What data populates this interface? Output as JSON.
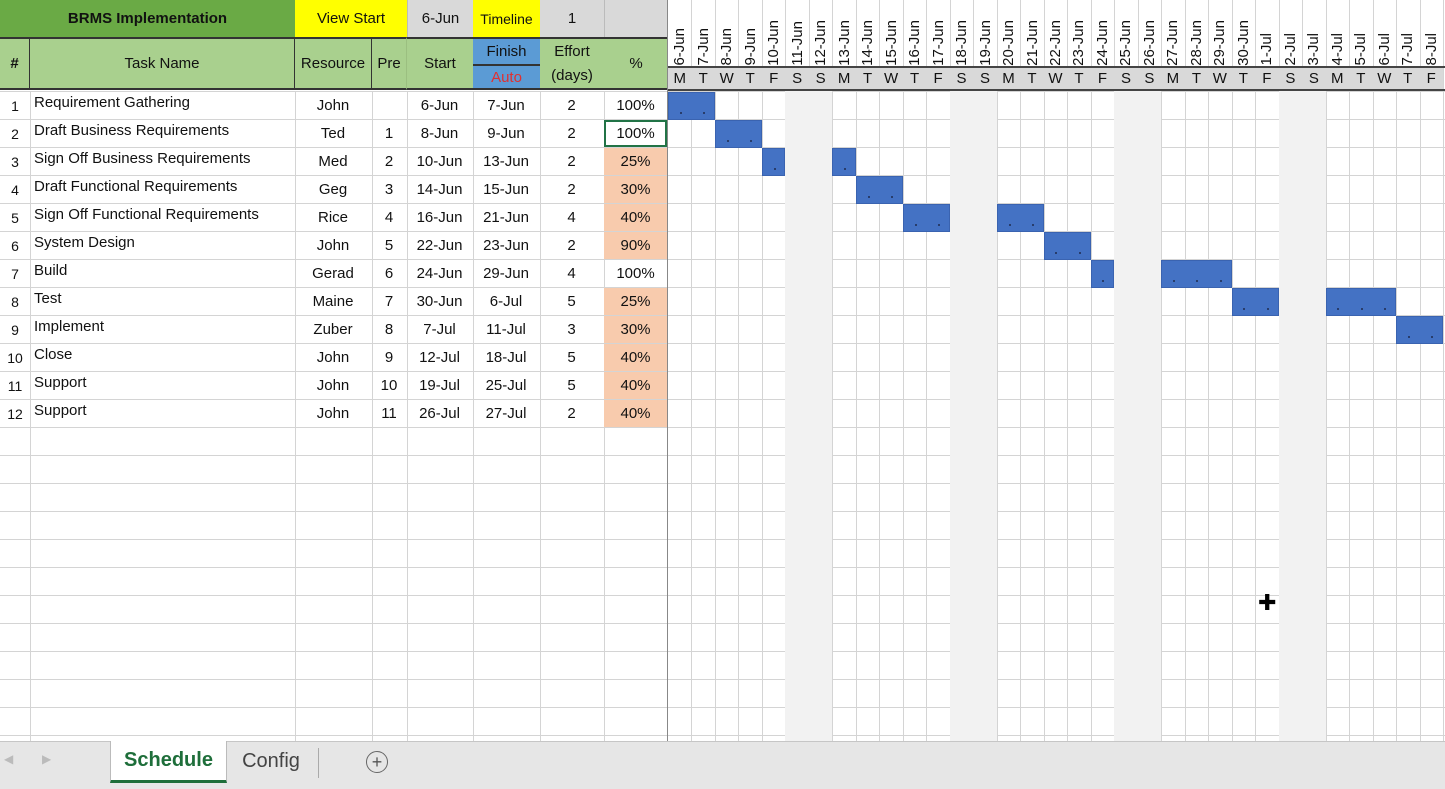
{
  "header": {
    "title": "BRMS Implementation",
    "view_start_label": "View Start",
    "view_start_value": "6-Jun",
    "timeline_label": "Timeline",
    "timeline_value": "1",
    "blank": ""
  },
  "columns": {
    "num": "#",
    "task": "Task Name",
    "resource": "Resource",
    "pre": "Pre",
    "start": "Start",
    "finish": "Finish",
    "finish_mode": "Auto",
    "effort": "Effort",
    "effort_unit": "(days)",
    "pct": "%"
  },
  "tasks": [
    {
      "num": "1",
      "name": "Requirement Gathering",
      "resource": "John",
      "pre": "",
      "start": "6-Jun",
      "finish": "7-Jun",
      "effort": "2",
      "pct": "100%",
      "highlight": false,
      "bar_days": [
        0,
        1
      ]
    },
    {
      "num": "2",
      "name": "Draft Business Requirements",
      "resource": "Ted",
      "pre": "1",
      "start": "8-Jun",
      "finish": "9-Jun",
      "effort": "2",
      "pct": "100%",
      "highlight": false,
      "selected": true,
      "bar_days": [
        2,
        3
      ]
    },
    {
      "num": "3",
      "name": "Sign Off Business Requirements",
      "resource": "Med",
      "pre": "2",
      "start": "10-Jun",
      "finish": "13-Jun",
      "effort": "2",
      "pct": "25%",
      "highlight": true,
      "bar_days": [
        4,
        7
      ]
    },
    {
      "num": "4",
      "name": "Draft Functional Requirements",
      "resource": "Geg",
      "pre": "3",
      "start": "14-Jun",
      "finish": "15-Jun",
      "effort": "2",
      "pct": "30%",
      "highlight": true,
      "bar_days": [
        8,
        9
      ]
    },
    {
      "num": "5",
      "name": "Sign Off Functional Requirements",
      "resource": "Rice",
      "pre": "4",
      "start": "16-Jun",
      "finish": "21-Jun",
      "effort": "4",
      "pct": "40%",
      "highlight": true,
      "bar_days": [
        10,
        11,
        14,
        15
      ]
    },
    {
      "num": "6",
      "name": "System Design",
      "resource": "John",
      "pre": "5",
      "start": "22-Jun",
      "finish": "23-Jun",
      "effort": "2",
      "pct": "90%",
      "highlight": true,
      "bar_days": [
        16,
        17
      ]
    },
    {
      "num": "7",
      "name": "Build",
      "resource": "Gerad",
      "pre": "6",
      "start": "24-Jun",
      "finish": "29-Jun",
      "effort": "4",
      "pct": "100%",
      "highlight": false,
      "bar_days": [
        18,
        21,
        22,
        23
      ]
    },
    {
      "num": "8",
      "name": "Test",
      "resource": "Maine",
      "pre": "7",
      "start": "30-Jun",
      "finish": "6-Jul",
      "effort": "5",
      "pct": "25%",
      "highlight": true,
      "bar_days": [
        24,
        25,
        28,
        29,
        30
      ]
    },
    {
      "num": "9",
      "name": "Implement",
      "resource": "Zuber",
      "pre": "8",
      "start": "7-Jul",
      "finish": "11-Jul",
      "effort": "3",
      "pct": "30%",
      "highlight": true,
      "bar_days": [
        31,
        32
      ]
    },
    {
      "num": "10",
      "name": "Close",
      "resource": "John",
      "pre": "9",
      "start": "12-Jul",
      "finish": "18-Jul",
      "effort": "5",
      "pct": "40%",
      "highlight": true,
      "bar_days": []
    },
    {
      "num": "11",
      "name": "Support",
      "resource": "John",
      "pre": "10",
      "start": "19-Jul",
      "finish": "25-Jul",
      "effort": "5",
      "pct": "40%",
      "highlight": true,
      "bar_days": []
    },
    {
      "num": "12",
      "name": "Support",
      "resource": "John",
      "pre": "11",
      "start": "26-Jul",
      "finish": "27-Jul",
      "effort": "2",
      "pct": "40%",
      "highlight": true,
      "bar_days": []
    }
  ],
  "timeline": {
    "dates": [
      "6-Jun",
      "7-Jun",
      "8-Jun",
      "9-Jun",
      "10-Jun",
      "11-Jun",
      "12-Jun",
      "13-Jun",
      "14-Jun",
      "15-Jun",
      "16-Jun",
      "17-Jun",
      "18-Jun",
      "19-Jun",
      "20-Jun",
      "21-Jun",
      "22-Jun",
      "23-Jun",
      "24-Jun",
      "25-Jun",
      "26-Jun",
      "27-Jun",
      "28-Jun",
      "29-Jun",
      "30-Jun",
      "1-Jul",
      "2-Jul",
      "3-Jul",
      "4-Jul",
      "5-Jul",
      "6-Jul",
      "7-Jul",
      "8-Jul"
    ],
    "days": [
      "M",
      "T",
      "W",
      "T",
      "F",
      "S",
      "S",
      "M",
      "T",
      "W",
      "T",
      "F",
      "S",
      "S",
      "M",
      "T",
      "W",
      "T",
      "F",
      "S",
      "S",
      "M",
      "T",
      "W",
      "T",
      "F",
      "S",
      "S",
      "M",
      "T",
      "W",
      "T",
      "F"
    ],
    "bar_color": "#4472c4"
  },
  "sheet_tabs": {
    "active": "Schedule",
    "other": "Config",
    "add": "+",
    "prev": "◀",
    "next": "▶"
  }
}
